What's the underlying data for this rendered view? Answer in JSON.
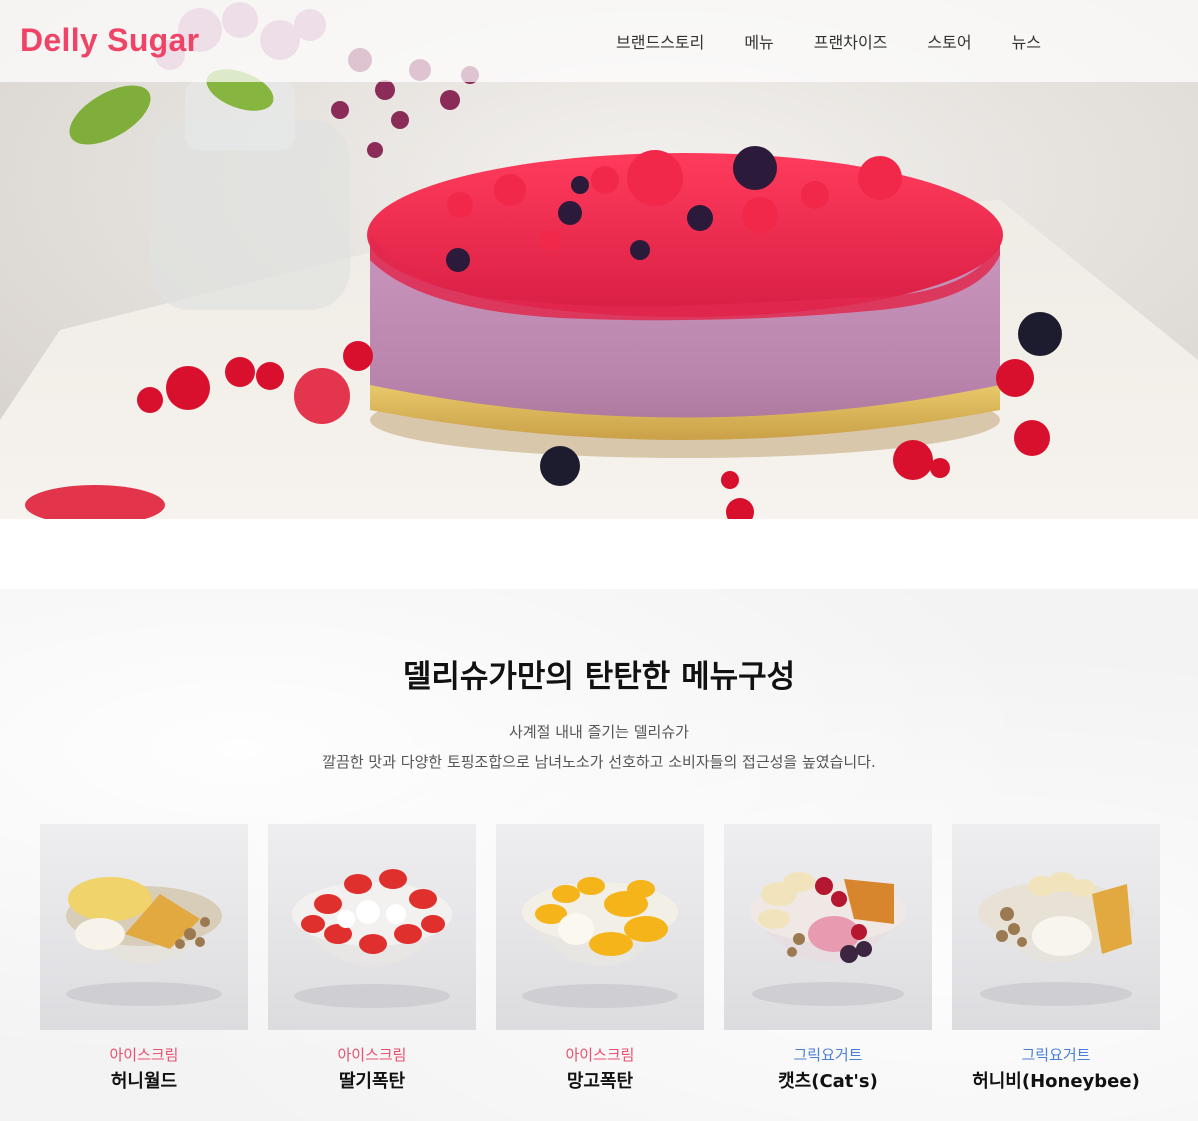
{
  "brand": {
    "logo": "Delly Sugar",
    "accent_color": "#ef4466"
  },
  "nav": {
    "items": [
      {
        "label": "브랜드스토리"
      },
      {
        "label": "메뉴"
      },
      {
        "label": "프랜차이즈"
      },
      {
        "label": "스토어"
      },
      {
        "label": "뉴스"
      }
    ]
  },
  "hero": {
    "image": "berry-mousse-cake-photo"
  },
  "menu_section": {
    "title": "델리슈가만의 탄탄한 메뉴구성",
    "description_line1": "사계절 내내 즐기는 델리슈가",
    "description_line2": "깔끔한 맛과 다양한 토핑조합으로 남녀노소가 선호하고 소비자들의 접근성을 높였습니다.",
    "items": [
      {
        "category": "아이스크림",
        "name": "허니월드",
        "category_color": "#e8506e",
        "image": "honey-world-bowl-photo"
      },
      {
        "category": "아이스크림",
        "name": "딸기폭탄",
        "category_color": "#e8506e",
        "image": "strawberry-bomb-bowl-photo"
      },
      {
        "category": "아이스크림",
        "name": "망고폭탄",
        "category_color": "#e8506e",
        "image": "mango-bomb-bowl-photo"
      },
      {
        "category": "그릭요거트",
        "name": "캣츠(Cat's)",
        "category_color": "#4a7fd6",
        "image": "cats-yogurt-bowl-photo"
      },
      {
        "category": "그릭요거트",
        "name": "허니비(Honeybee)",
        "category_color": "#4a7fd6",
        "image": "honeybee-yogurt-bowl-photo"
      }
    ]
  }
}
